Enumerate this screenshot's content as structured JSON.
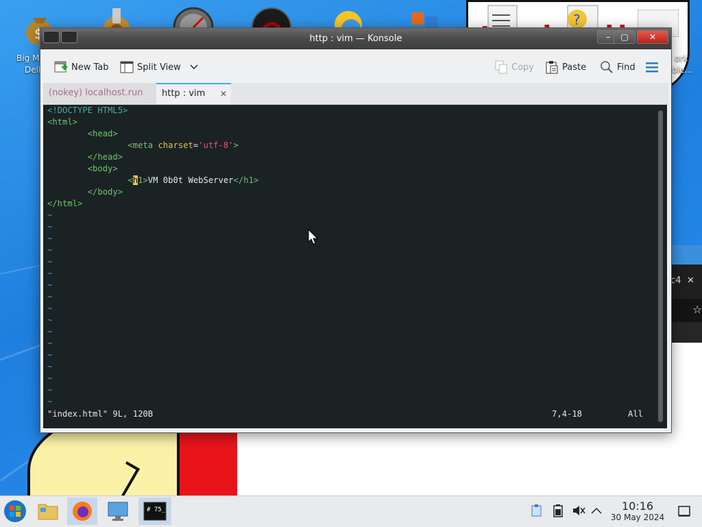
{
  "window": {
    "title": "http : vim — Konsole",
    "minimize_glyph": "–",
    "maximize_glyph": "▢",
    "close_glyph": "✕"
  },
  "desktop": {
    "icons": [
      {
        "name": "money-bag-icon",
        "label": "Big M…\nDell"
      },
      {
        "name": "gear-money-icon",
        "label": ""
      },
      {
        "name": "gauge-icon",
        "label": ""
      },
      {
        "name": "dark-disc-icon",
        "label": ""
      },
      {
        "name": "sun-globe-icon",
        "label": ""
      },
      {
        "name": "office-icon",
        "label": ""
      },
      {
        "name": "document-icon",
        "label": ""
      },
      {
        "name": "help-document-icon",
        "label": ""
      },
      {
        "name": "archive-icon",
        "label": "ork\nble..."
      }
    ],
    "cloud_text": "t  s ist  llv",
    "side_panel_text": "c4",
    "side_panel_close": "✕",
    "side_panel_star": "☆"
  },
  "toolbar": {
    "new_tab": "New Tab",
    "split_view": "Split View",
    "copy": "Copy",
    "paste": "Paste",
    "find": "Find"
  },
  "tabs": [
    {
      "label": "(nokey) localhost.run",
      "active": false
    },
    {
      "label": "http : vim",
      "active": true
    }
  ],
  "editor": {
    "lines": [
      "<!DOCTYPE HTML5>",
      "<html>",
      "        <head>",
      "                <meta charset='utf-8'>",
      "        </head>",
      "        <body>",
      "                <h1>VM 0b0t WebServer</h1>",
      "        </body>",
      "</html>"
    ],
    "tilde_rows": 17,
    "status_file": "\"index.html\" 9L, 120B",
    "status_position": "7,4-18",
    "status_scroll": "All"
  },
  "taskbar": {
    "items": [
      "start-menu",
      "file-manager",
      "firefox",
      "system-settings",
      "konsole"
    ],
    "time": "10:16",
    "date": "30 May 2024"
  },
  "colors": {
    "tag": "#6ec46a",
    "attr": "#d9c54f",
    "string": "#e0567a",
    "doctype": "#4ea99b",
    "tilde": "#3d9bdf",
    "terminal_bg": "#1b2224",
    "accent": "#3daee9"
  }
}
